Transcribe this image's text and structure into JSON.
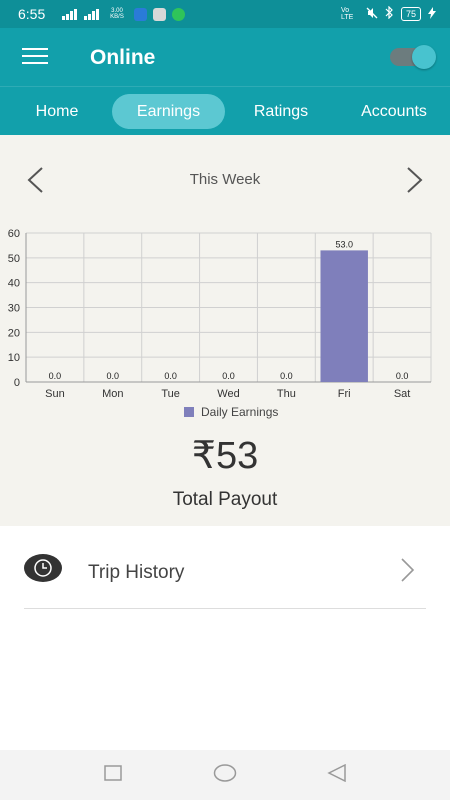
{
  "status": {
    "time": "6:55",
    "speed": "3.00 KB/S",
    "volte": "Vo LTE",
    "battery": "75"
  },
  "header": {
    "title": "Online"
  },
  "tabs": [
    {
      "label": "Home"
    },
    {
      "label": "Earnings"
    },
    {
      "label": "Ratings"
    },
    {
      "label": "Accounts"
    }
  ],
  "week": {
    "label": "This Week"
  },
  "chart_data": {
    "type": "bar",
    "categories": [
      "Sun",
      "Mon",
      "Tue",
      "Wed",
      "Thu",
      "Fri",
      "Sat"
    ],
    "values": [
      0.0,
      0.0,
      0.0,
      0.0,
      0.0,
      53.0,
      0.0
    ],
    "value_labels": [
      "0.0",
      "0.0",
      "0.0",
      "0.0",
      "0.0",
      "53.0",
      "0.0"
    ],
    "series": [
      {
        "name": "Daily Earnings",
        "color": "#7f7fbb"
      }
    ],
    "ylim": [
      0,
      60
    ],
    "yticks": [
      "0",
      "10",
      "20",
      "30",
      "40",
      "50",
      "60"
    ],
    "grid": true,
    "legend": "bottom"
  },
  "payout": {
    "amount": "₹53",
    "label": "Total Payout"
  },
  "trip_history": {
    "label": "Trip History"
  },
  "colors": {
    "primary": "#12a0ab",
    "active_tab": "#5cc8d2",
    "bar": "#7f7fbb"
  }
}
